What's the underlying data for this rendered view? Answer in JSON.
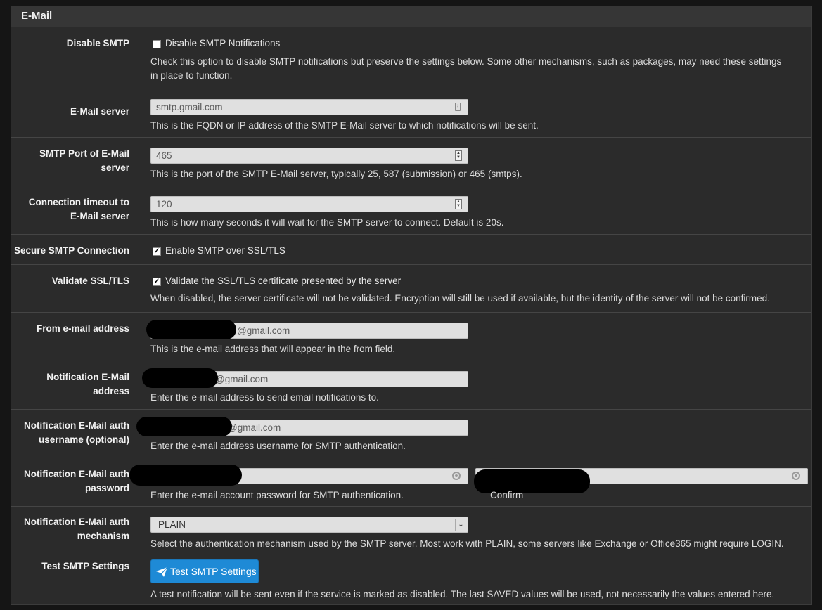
{
  "section": {
    "title": "E-Mail"
  },
  "disable_smtp": {
    "label": "Disable SMTP",
    "checkbox_label": "Disable SMTP Notifications",
    "checked": false,
    "help_line1": "Check this option to disable SMTP notifications but preserve the settings below. Some other mechanisms, such as packages, may need these settings",
    "help_line2": "in place to function."
  },
  "email_server": {
    "label": "E-Mail server",
    "value": "smtp.gmail.com",
    "help": "This is the FQDN or IP address of the SMTP E-Mail server to which notifications will be sent."
  },
  "smtp_port": {
    "label_line1": "SMTP Port of E-Mail",
    "label_line2": "server",
    "value": "465",
    "help": "This is the port of the SMTP E-Mail server, typically 25, 587 (submission) or 465 (smtps)."
  },
  "timeout": {
    "label_line1": "Connection timeout to",
    "label_line2": "E-Mail server",
    "value": "120",
    "help": "This is how many seconds it will wait for the SMTP server to connect. Default is 20s."
  },
  "secure_smtp": {
    "label": "Secure SMTP Connection",
    "checkbox_label": "Enable SMTP over SSL/TLS",
    "checked": true
  },
  "validate_ssl": {
    "label": "Validate SSL/TLS",
    "checkbox_label": "Validate the SSL/TLS certificate presented by the server",
    "checked": true,
    "help": "When disabled, the server certificate will not be validated. Encryption will still be used if available, but the identity of the server will not be confirmed."
  },
  "from_address": {
    "label": "From e-mail address",
    "value": "@gmail.com",
    "help": "This is the e-mail address that will appear in the from field."
  },
  "notification_address": {
    "label_line1": "Notification E-Mail",
    "label_line2": "address",
    "value": "@gmail.com",
    "help": "Enter the e-mail address to send email notifications to."
  },
  "auth_username": {
    "label_line1": "Notification E-Mail auth",
    "label_line2": "username (optional)",
    "value": "@gmail.com",
    "help": "Enter the e-mail address username for SMTP authentication."
  },
  "auth_password": {
    "label_line1": "Notification E-Mail auth",
    "label_line2": "password",
    "help": "Enter the e-mail account password for SMTP authentication.",
    "confirm_label": "Confirm"
  },
  "auth_mechanism": {
    "label_line1": "Notification E-Mail auth",
    "label_line2": "mechanism",
    "selected": "PLAIN",
    "help": "Select the authentication mechanism used by the SMTP server. Most work with PLAIN, some servers like Exchange or Office365 might require LOGIN."
  },
  "test_smtp": {
    "label": "Test SMTP Settings",
    "button_label": "Test SMTP Settings",
    "help": "A test notification will be sent even if the service is marked as disabled. The last SAVED values will be used, not necessarily the values entered here."
  },
  "colors": {
    "background": "#151515",
    "panel": "#2b2b2b",
    "accent": "#1e8ad6"
  },
  "icons": [
    "field-icon",
    "spinner-icon",
    "eye-icon",
    "chevron-down-icon",
    "paper-plane-icon"
  ]
}
